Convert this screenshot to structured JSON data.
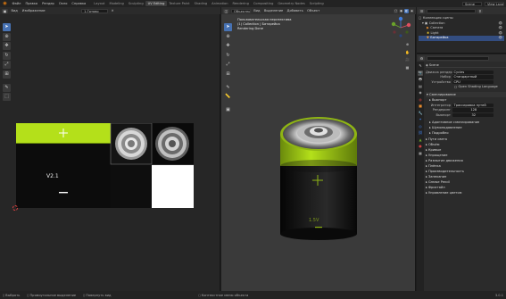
{
  "topbar": {
    "menus": [
      "Файл",
      "Правка",
      "Рендер",
      "Окно",
      "Справка"
    ],
    "workspaces": [
      "Layout",
      "Modeling",
      "Sculpting",
      "UV Editing",
      "Texture Paint",
      "Shading",
      "Animation",
      "Rendering",
      "Compositing",
      "Geometry Nodes",
      "Scripting"
    ],
    "active_workspace_index": 3,
    "scene_label": "Scene",
    "view_layer_label": "View Layer"
  },
  "image_editor": {
    "view_menu": "Вид",
    "image_menu": "Изображение",
    "image_name": "1.Готово",
    "texture": {
      "label_text": "V2.1",
      "plus_symbol": "+",
      "accent_color": "#b4e01a"
    }
  },
  "viewport": {
    "mode_label": "Объектный ...",
    "menus": [
      "Вид",
      "Выделение",
      "Добавить",
      "Объект"
    ],
    "info_lines": [
      "Пользовательская перспектива",
      "(1) Collection | Батарейка",
      "Rendering Done"
    ],
    "battery": {
      "plus_symbol": "+",
      "voltage_text": "1.5V",
      "accent_color": "#b4e01a"
    }
  },
  "outliner": {
    "search_placeholder": "",
    "items": [
      {
        "label": "Коллекция сцены",
        "indent": 0
      },
      {
        "label": "Collection",
        "indent": 1
      },
      {
        "label": "Camera",
        "indent": 2
      },
      {
        "label": "Light",
        "indent": 2
      },
      {
        "label": "Батарейка",
        "indent": 2
      }
    ]
  },
  "properties": {
    "section_render": "Scene",
    "render_engine_label": "Движок рендера",
    "render_engine_value": "Cycles",
    "feature_set_label": "Набор",
    "feature_set_value": "Стандартный",
    "device_label": "Устройство",
    "device_value": "CPU",
    "osl_label": "Open Shading Language",
    "sampling_header": "Сэмплирование",
    "viewport_subheader": "Вьюпорт",
    "integrator_label": "Интегратор",
    "integrator_value": "Трассировка путей",
    "render_samples_label": "Рендеринг",
    "render_samples_value": "128",
    "viewport_samples_label": "Вьюпорт",
    "viewport_samples_value": "32",
    "sub_sections": [
      "Адаптивное сэмплирование",
      "Шумоподавление",
      "Подробно"
    ],
    "sections": [
      "Пути света",
      "Объём",
      "Кривые",
      "Упрощение",
      "Размытие движения",
      "Плёнка",
      "Производительность",
      "Запекание",
      "Grease Pencil",
      "Фристайл",
      "Управление цветом"
    ]
  },
  "statusbar": {
    "items": [
      "Выбрать",
      "Прямоугольное выделение",
      "Повернуть вид",
      "Контекстное меню объекта"
    ],
    "version": "3.0.1"
  },
  "colors": {
    "accent_blue": "#4772b3",
    "battery_green": "#b4e01a",
    "blender_orange": "#e87d0d"
  }
}
